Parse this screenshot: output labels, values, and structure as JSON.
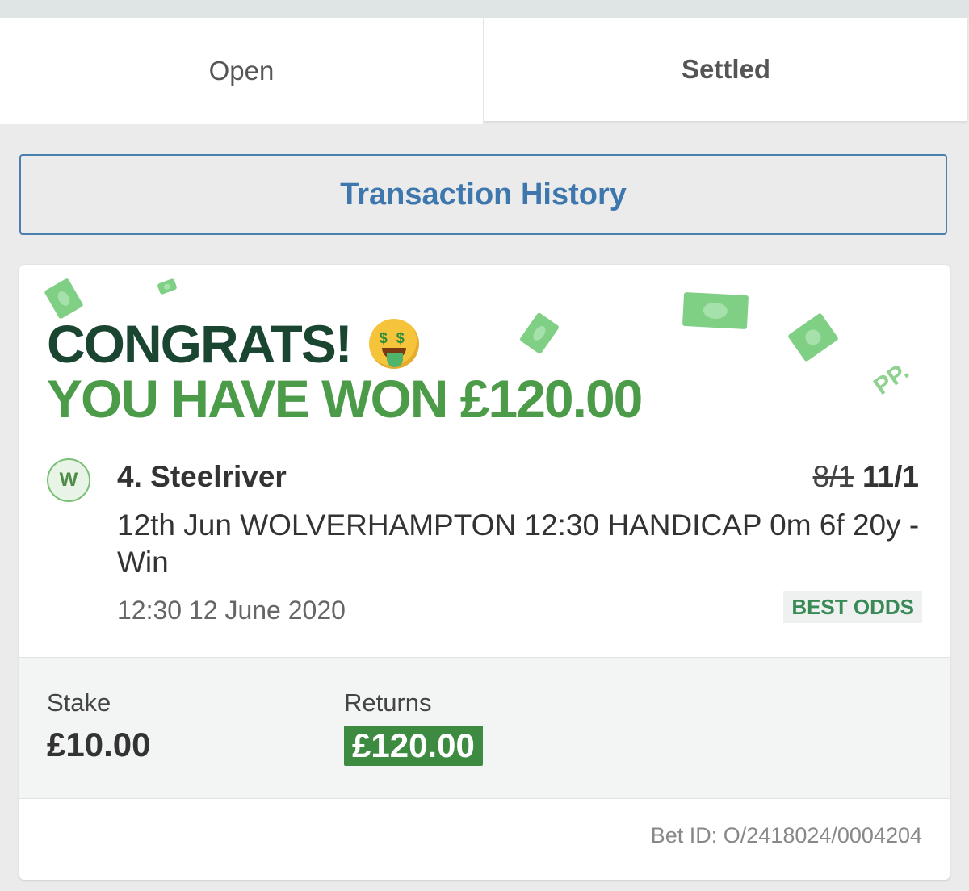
{
  "tabs": [
    {
      "label": "Open",
      "active": false
    },
    {
      "label": "Settled",
      "active": true
    }
  ],
  "transaction_history_label": "Transaction History",
  "bet": {
    "headline": "CONGRATS!",
    "won_text": "YOU HAVE WON £120.00",
    "brand_mark": "PP.",
    "result_badge": "W",
    "runner": "4. Steelriver",
    "old_odds": "8/1",
    "new_odds": "11/1",
    "event": "12th Jun WOLVERHAMPTON 12:30 HANDICAP 0m 6f 20y - Win",
    "datetime": "12:30 12 June 2020",
    "best_odds_label": "BEST ODDS",
    "stake_label": "Stake",
    "stake_value": "£10.00",
    "returns_label": "Returns",
    "returns_value": "£120.00",
    "bet_id": "Bet ID: O/2418024/0004204"
  },
  "colors": {
    "accent_blue": "#3d77ad",
    "dark_green": "#1a4531",
    "win_green": "#4b9b49",
    "returns_bg": "#3d8a41"
  }
}
